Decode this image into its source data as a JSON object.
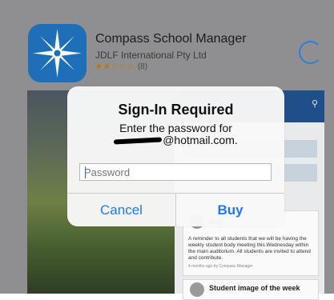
{
  "app": {
    "name": "Compass School Manager",
    "developer": "JDLF International Pty Ltd",
    "stars": "★★☆☆☆",
    "rating_count": "(8)"
  },
  "preview": {
    "card_text": "A reminder to all students that we will be having the weekly student body meeting this Wednesday within the main auditorium.  All students are invited to attend and contribute.",
    "card_meta": "4 months ago by Compass Manager",
    "card_title_partial": "ting",
    "card2_title": "Student image of the week"
  },
  "alert": {
    "title": "Sign-In Required",
    "message_line1": "Enter the password for",
    "email_visible": "@hotmail.com.",
    "password_placeholder": "Password",
    "cancel_label": "Cancel",
    "buy_label": "Buy"
  },
  "colors": {
    "accent": "#1d7bf2",
    "app_icon": "#1f6fb8"
  }
}
